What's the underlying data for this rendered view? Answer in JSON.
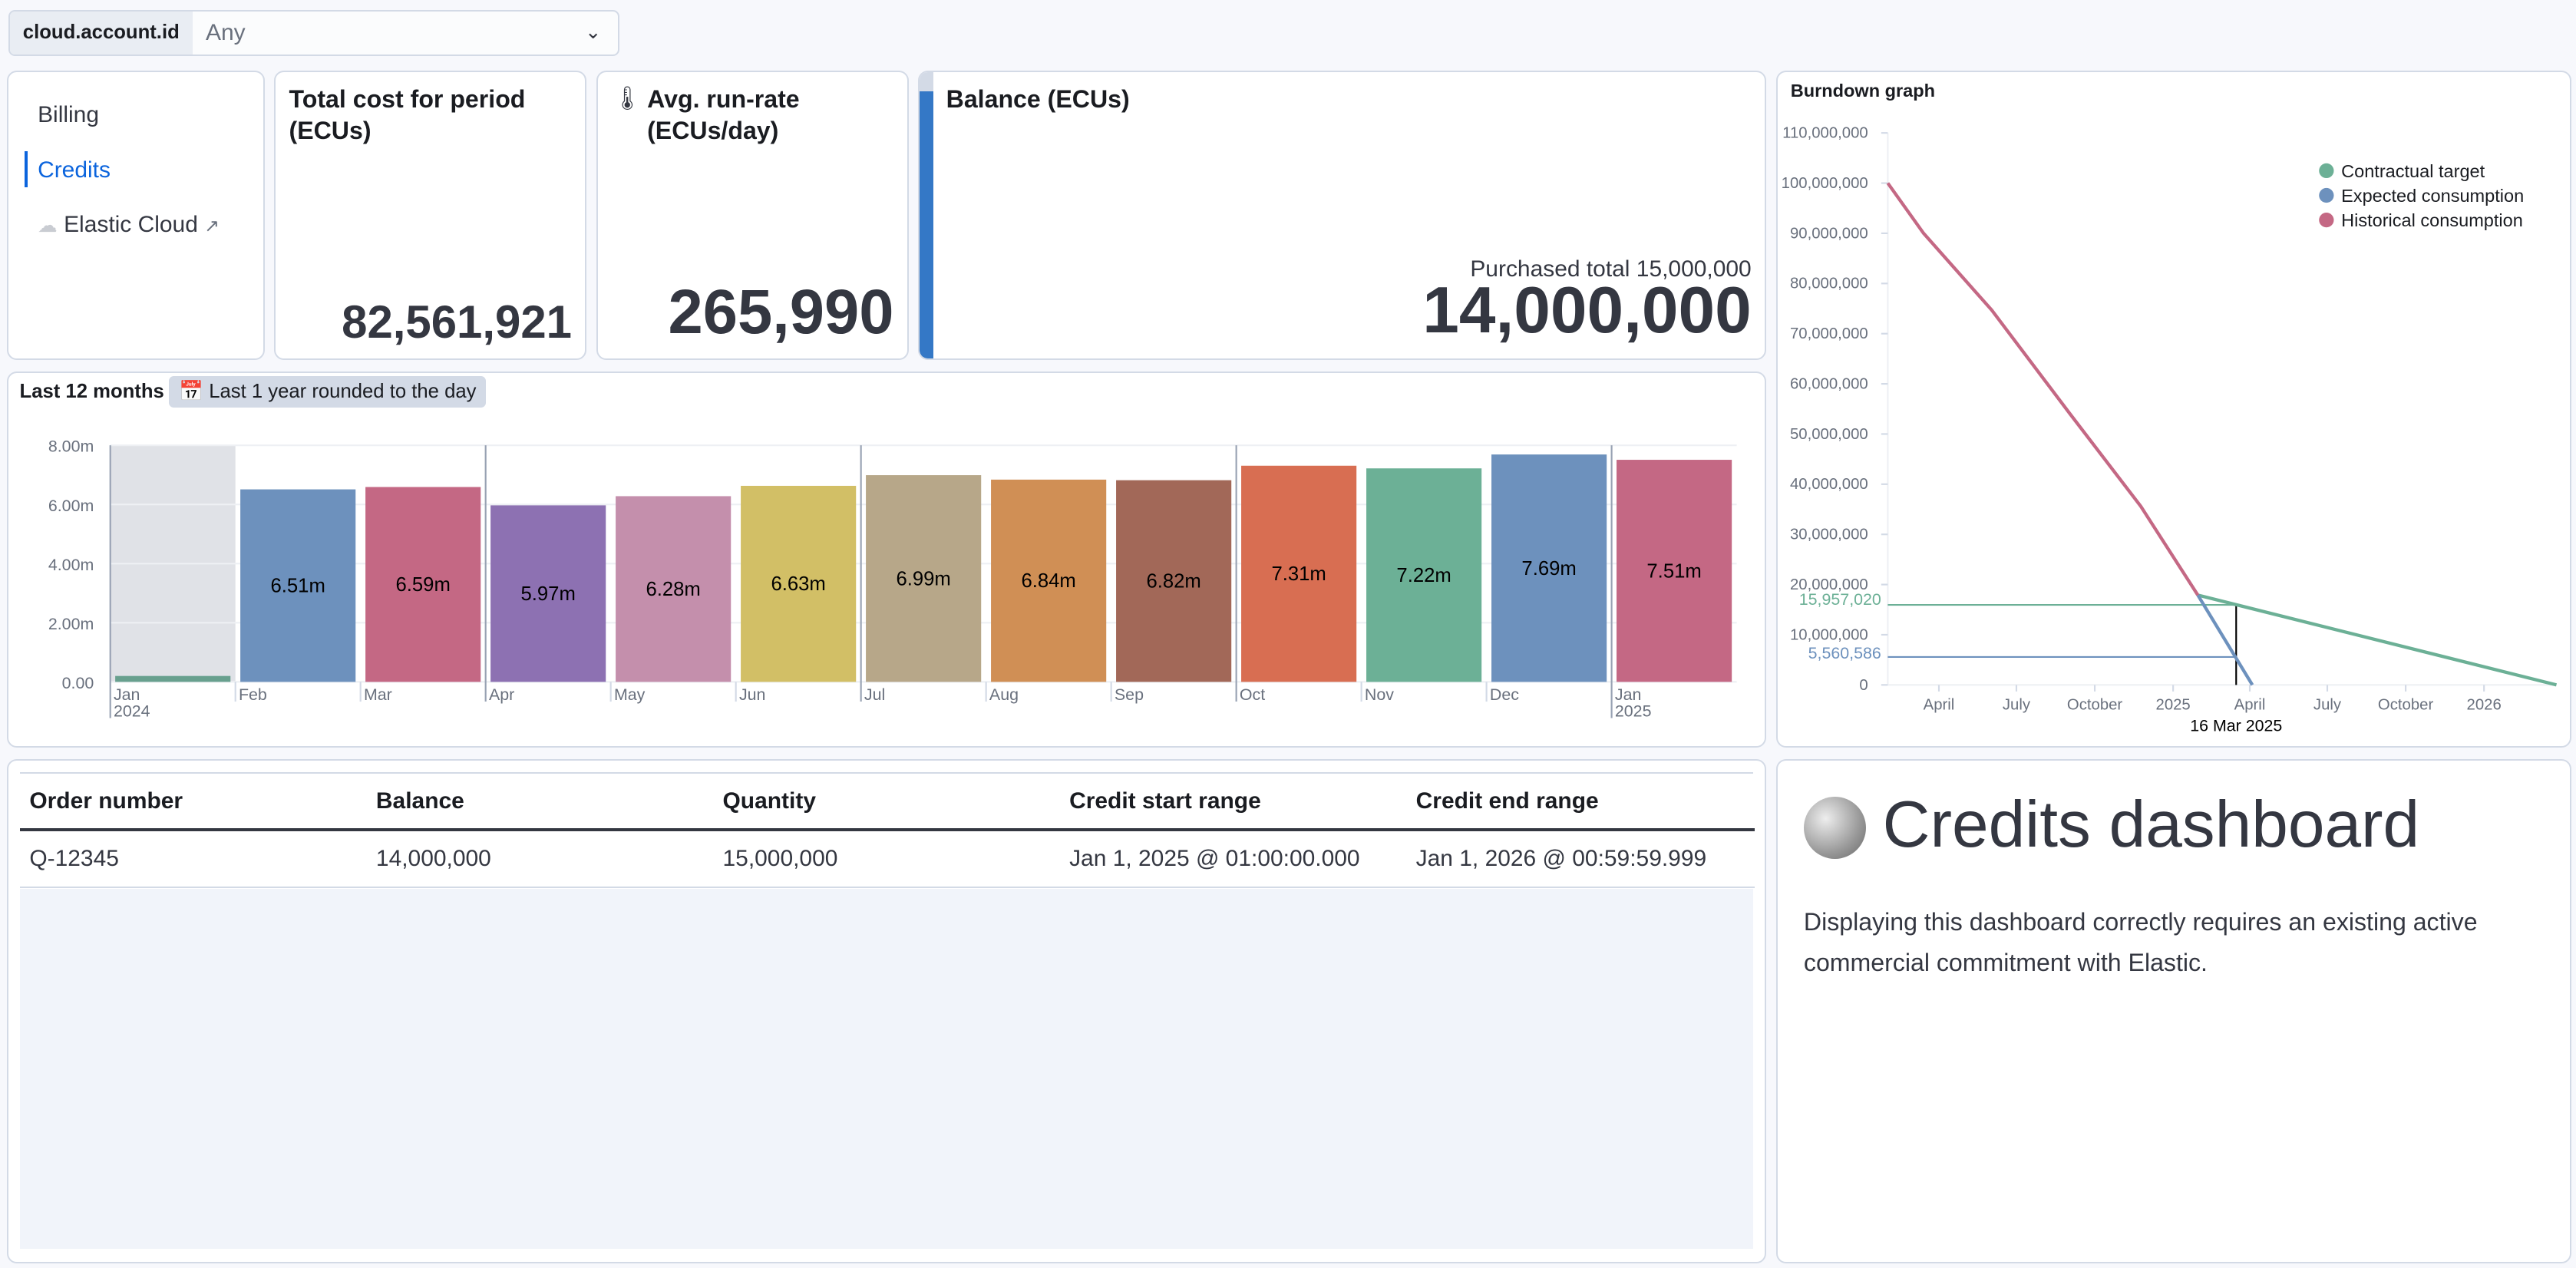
{
  "filter": {
    "label": "cloud.account.id",
    "value": "Any"
  },
  "nav": {
    "items": [
      {
        "label": "Billing",
        "active": false
      },
      {
        "label": "Credits",
        "active": true
      },
      {
        "label": "Elastic Cloud",
        "external": true
      }
    ]
  },
  "metrics": {
    "total": {
      "title": "Total cost for period (ECUs)",
      "value": "82,561,921"
    },
    "avg": {
      "title": "Avg. run-rate (ECUs/day)",
      "value": "265,990",
      "icon": "thermometer-icon"
    },
    "balance": {
      "title": "Balance (ECUs)",
      "subtitle": "Purchased total 15,000,000",
      "value": "14,000,000",
      "progress_fraction": 0.9333,
      "color": "#3478c6"
    }
  },
  "bar_panel": {
    "title": "Last 12 months",
    "badge": "Last 1 year rounded to the day"
  },
  "table": {
    "columns": [
      "Order number",
      "Balance",
      "Quantity",
      "Credit start range",
      "Credit end range"
    ],
    "rows": [
      [
        "Q-12345",
        "14,000,000",
        "15,000,000",
        "Jan 1, 2025 @ 01:00:00.000",
        "Jan 1, 2026 @ 00:59:59.999"
      ]
    ]
  },
  "info": {
    "title": "Credits dashboard",
    "text": "Displaying this dashboard correctly requires an existing active commercial commitment with Elastic."
  },
  "chart_data": [
    {
      "type": "bar",
      "categories": [
        "Jan 2024",
        "Feb",
        "Mar",
        "Apr",
        "May",
        "Jun",
        "Jul",
        "Aug",
        "Sep",
        "Oct",
        "Nov",
        "Dec",
        "Jan 2025"
      ],
      "tick_labels": [
        [
          "Jan",
          "2024"
        ],
        [
          "Feb"
        ],
        [
          "Mar"
        ],
        [
          "Apr"
        ],
        [
          "May"
        ],
        [
          "Jun"
        ],
        [
          "Jul"
        ],
        [
          "Aug"
        ],
        [
          "Sep"
        ],
        [
          "Oct"
        ],
        [
          "Nov"
        ],
        [
          "Dec"
        ],
        [
          "Jan",
          "2025"
        ]
      ],
      "values": [
        0.2,
        6.51,
        6.59,
        5.97,
        6.28,
        6.63,
        6.99,
        6.84,
        6.82,
        7.31,
        7.22,
        7.69,
        7.51
      ],
      "data_labels": [
        "",
        "6.51m",
        "6.59m",
        "5.97m",
        "6.28m",
        "6.63m",
        "6.99m",
        "6.84m",
        "6.82m",
        "7.31m",
        "7.22m",
        "7.69m",
        "7.51m"
      ],
      "colors": [
        "#68a08e",
        "#6d91bd",
        "#c46884",
        "#8d71b2",
        "#c48fac",
        "#d2bf66",
        "#b7a789",
        "#d08f55",
        "#a26858",
        "#d86e52",
        "#6cb096",
        "#6d91bd",
        "#c46884"
      ],
      "y_ticks": [
        "0.00",
        "2.00m",
        "4.00m",
        "6.00m",
        "8.00m"
      ],
      "ylim": [
        0,
        8
      ],
      "highlighted_category": "Jan 2024",
      "grid": true
    },
    {
      "type": "line",
      "title": "Burndown graph",
      "y_ticks": [
        "0",
        "10,000,000",
        "20,000,000",
        "30,000,000",
        "40,000,000",
        "50,000,000",
        "60,000,000",
        "70,000,000",
        "80,000,000",
        "90,000,000",
        "100,000,000",
        "110,000,000"
      ],
      "ylim": [
        0,
        110000000
      ],
      "xlim": [
        "2024-02-01",
        "2026-03-27"
      ],
      "x_ticks": [
        {
          "date": "2024-04-01",
          "label": "April"
        },
        {
          "date": "2024-07-01",
          "label": "July"
        },
        {
          "date": "2024-10-01",
          "label": "October"
        },
        {
          "date": "2025-01-01",
          "label": "2025"
        },
        {
          "date": "2025-04-01",
          "label": "April"
        },
        {
          "date": "2025-07-01",
          "label": "July"
        },
        {
          "date": "2025-10-01",
          "label": "October"
        },
        {
          "date": "2026-01-01",
          "label": "2026"
        }
      ],
      "legend_position": "top-right",
      "series": [
        {
          "name": "Contractual target",
          "color": "#6cb096",
          "points": [
            [
              "2025-01-30",
              17900000
            ],
            [
              "2026-03-27",
              0
            ]
          ]
        },
        {
          "name": "Expected consumption",
          "color": "#6d91bd",
          "points": [
            [
              "2025-01-30",
              17900000
            ],
            [
              "2025-04-04",
              0
            ]
          ]
        },
        {
          "name": "Historical consumption",
          "color": "#c46884",
          "points": [
            [
              "2024-02-01",
              100000000
            ],
            [
              "2024-03-14",
              90000000
            ],
            [
              "2024-06-02",
              74700000
            ],
            [
              "2024-09-02",
              54000000
            ],
            [
              "2024-11-24",
              35600000
            ],
            [
              "2025-01-30",
              17900000
            ]
          ]
        }
      ],
      "crosshair": {
        "date_label": "16 Mar 2025",
        "date": "2025-03-16",
        "values": [
          {
            "series": "Contractual target",
            "label": "15,957,020",
            "value": 15957020
          },
          {
            "series": "Expected consumption",
            "label": "5,560,586",
            "value": 5560586
          }
        ]
      }
    }
  ]
}
